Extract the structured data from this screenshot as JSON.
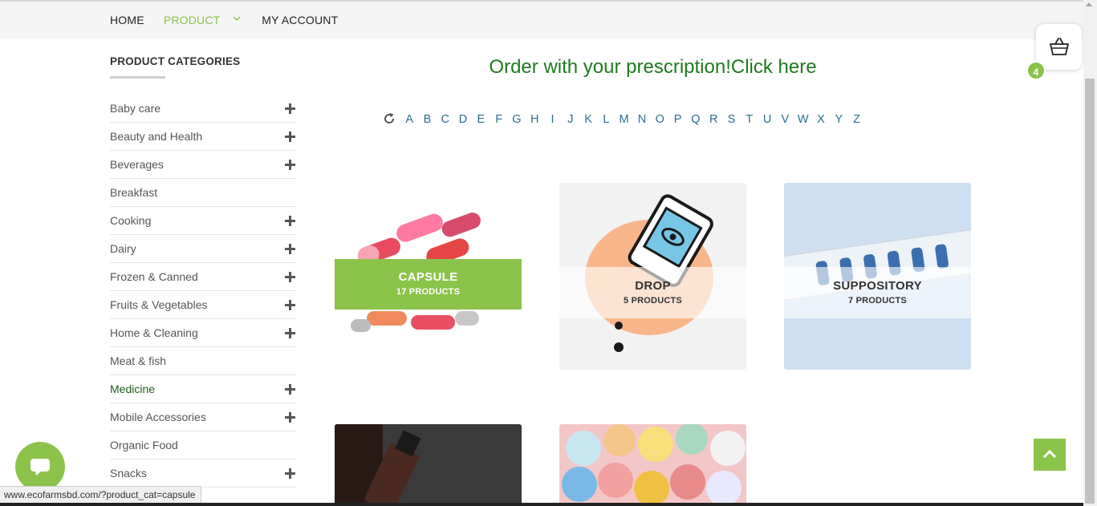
{
  "nav": {
    "home": "HOME",
    "product": "PRODUCT",
    "account": "MY ACCOUNT"
  },
  "sidebar": {
    "title": "PRODUCT CATEGORIES",
    "items": [
      {
        "label": "Baby care",
        "expandable": true
      },
      {
        "label": "Beauty and Health",
        "expandable": true
      },
      {
        "label": "Beverages",
        "expandable": true
      },
      {
        "label": "Breakfast",
        "expandable": false
      },
      {
        "label": "Cooking",
        "expandable": true
      },
      {
        "label": "Dairy",
        "expandable": true
      },
      {
        "label": "Frozen & Canned",
        "expandable": true
      },
      {
        "label": "Fruits & Vegetables",
        "expandable": true
      },
      {
        "label": "Home & Cleaning",
        "expandable": true
      },
      {
        "label": "Meat & fish",
        "expandable": false
      },
      {
        "label": "Medicine",
        "expandable": true,
        "active": true
      },
      {
        "label": "Mobile Accessories",
        "expandable": true
      },
      {
        "label": "Organic Food",
        "expandable": false
      },
      {
        "label": "Snacks",
        "expandable": true
      }
    ]
  },
  "main": {
    "prescription_link": "Order with your prescription!Click here",
    "alphabet": [
      "A",
      "B",
      "C",
      "D",
      "E",
      "F",
      "G",
      "H",
      "I",
      "J",
      "K",
      "L",
      "M",
      "N",
      "O",
      "P",
      "Q",
      "R",
      "S",
      "T",
      "U",
      "V",
      "W",
      "X",
      "Y",
      "Z"
    ],
    "reset_icon": "refresh-icon",
    "products": [
      {
        "name": "CAPSULE",
        "count": "17 PRODUCTS"
      },
      {
        "name": "DROP",
        "count": "5 PRODUCTS"
      },
      {
        "name": "SUPPOSITORY",
        "count": "7 PRODUCTS"
      }
    ]
  },
  "cart": {
    "count": "4",
    "icon": "basket-icon"
  },
  "status_url": "www.ecofarmsbd.com/?product_cat=capsule",
  "colors": {
    "accent": "#8bc34a",
    "heading": "#1e7a1e",
    "alphabet": "#2c6e8c",
    "medicine_active": "#1e5c1e"
  }
}
